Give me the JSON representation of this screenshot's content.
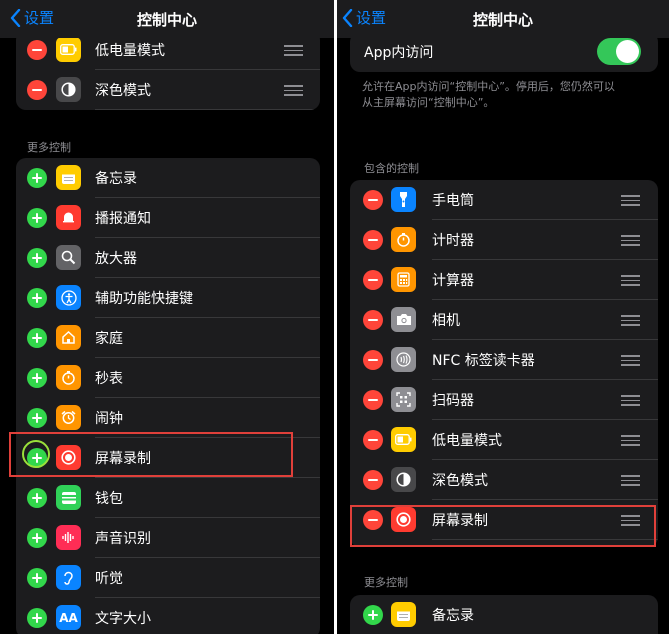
{
  "left": {
    "nav": {
      "back_label": "设置",
      "title": "控制中心"
    },
    "top_group": [
      {
        "label": "低电量模式",
        "icon": "battery-icon",
        "color": "#ffcc00"
      },
      {
        "label": "深色模式",
        "icon": "dark-mode-icon",
        "color": "#48484a"
      }
    ],
    "more_header": "更多控制",
    "more_items": [
      {
        "label": "备忘录",
        "icon": "notes-icon",
        "color": "#ffcc00"
      },
      {
        "label": "播报通知",
        "icon": "announce-notifications-icon",
        "color": "#ff3b30"
      },
      {
        "label": "放大器",
        "icon": "magnifier-icon",
        "color": "#636366"
      },
      {
        "label": "辅助功能快捷键",
        "icon": "accessibility-icon",
        "color": "#0a84ff"
      },
      {
        "label": "家庭",
        "icon": "home-icon",
        "color": "#ff9500"
      },
      {
        "label": "秒表",
        "icon": "stopwatch-icon",
        "color": "#ff9500"
      },
      {
        "label": "闹钟",
        "icon": "alarm-icon",
        "color": "#ff9500"
      },
      {
        "label": "屏幕录制",
        "icon": "screen-recording-icon",
        "color": "#ff3b30"
      },
      {
        "label": "钱包",
        "icon": "wallet-icon",
        "color": "#30d158"
      },
      {
        "label": "声音识别",
        "icon": "sound-recognition-icon",
        "color": "#ff2d55"
      },
      {
        "label": "听觉",
        "icon": "hearing-icon",
        "color": "#0a84ff"
      },
      {
        "label": "文字大小",
        "icon": "text-size-icon",
        "color": "#0a84ff",
        "glyph": "AA"
      }
    ]
  },
  "right": {
    "nav": {
      "back_label": "设置",
      "title": "控制中心"
    },
    "access": {
      "label": "App内访问",
      "enabled": true
    },
    "description_lines": [
      "允许在App内访问“控制中心”。停用后，您仍然可以",
      "从主屏幕访问“控制中心”。"
    ],
    "included_header": "包含的控制",
    "included_items": [
      {
        "label": "手电筒",
        "icon": "flashlight-icon",
        "color": "#0a84ff"
      },
      {
        "label": "计时器",
        "icon": "timer-icon",
        "color": "#ff9500"
      },
      {
        "label": "计算器",
        "icon": "calculator-icon",
        "color": "#ff9500"
      },
      {
        "label": "相机",
        "icon": "camera-icon",
        "color": "#8e8e93"
      },
      {
        "label": "NFC 标签读卡器",
        "icon": "nfc-reader-icon",
        "color": "#8e8e93"
      },
      {
        "label": "扫码器",
        "icon": "qr-scanner-icon",
        "color": "#8e8e93"
      },
      {
        "label": "低电量模式",
        "icon": "battery-icon",
        "color": "#ffcc00"
      },
      {
        "label": "深色模式",
        "icon": "dark-mode-icon",
        "color": "#48484a"
      },
      {
        "label": "屏幕录制",
        "icon": "screen-recording-icon",
        "color": "#ff3b30"
      }
    ],
    "more_header": "更多控制",
    "more_items": [
      {
        "label": "备忘录",
        "icon": "notes-icon",
        "color": "#ffcc00"
      }
    ]
  },
  "colors": {
    "highlight": "#e0403a",
    "plus_ring": "#9ae03a"
  }
}
